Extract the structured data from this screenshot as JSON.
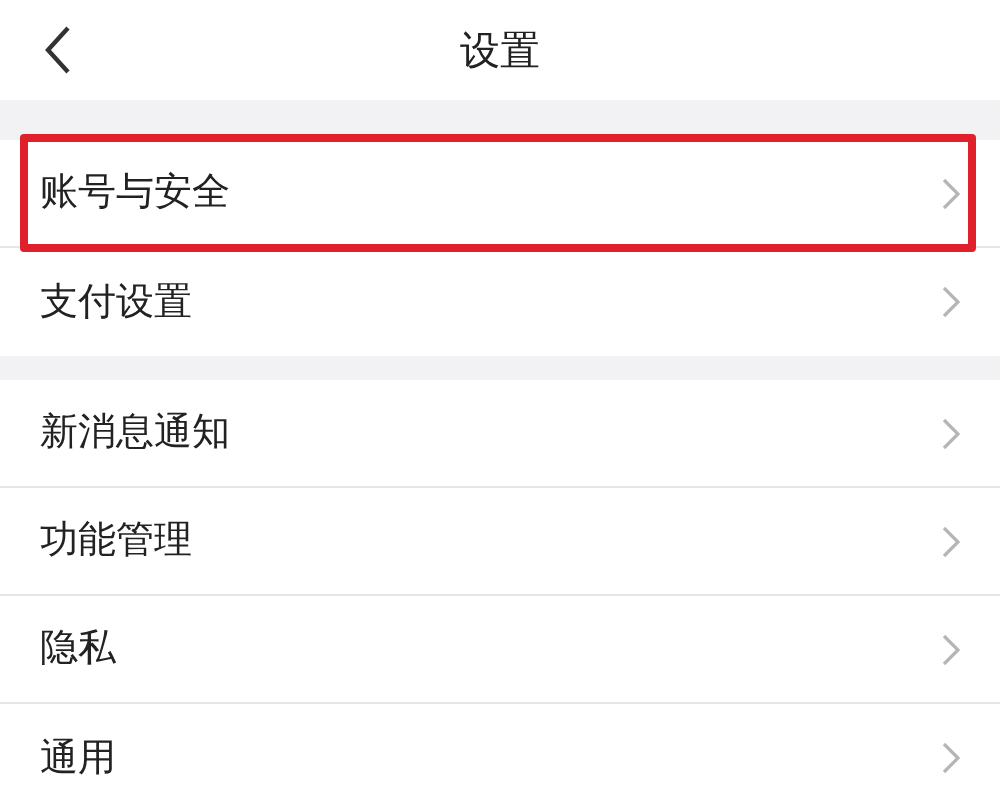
{
  "header": {
    "title": "设置"
  },
  "groups": [
    {
      "items": [
        {
          "label": "账号与安全",
          "highlighted": true
        },
        {
          "label": "支付设置",
          "highlighted": false
        }
      ]
    },
    {
      "items": [
        {
          "label": "新消息通知",
          "highlighted": false
        },
        {
          "label": "功能管理",
          "highlighted": false
        },
        {
          "label": "隐私",
          "highlighted": false
        },
        {
          "label": "通用",
          "highlighted": false
        }
      ]
    }
  ]
}
